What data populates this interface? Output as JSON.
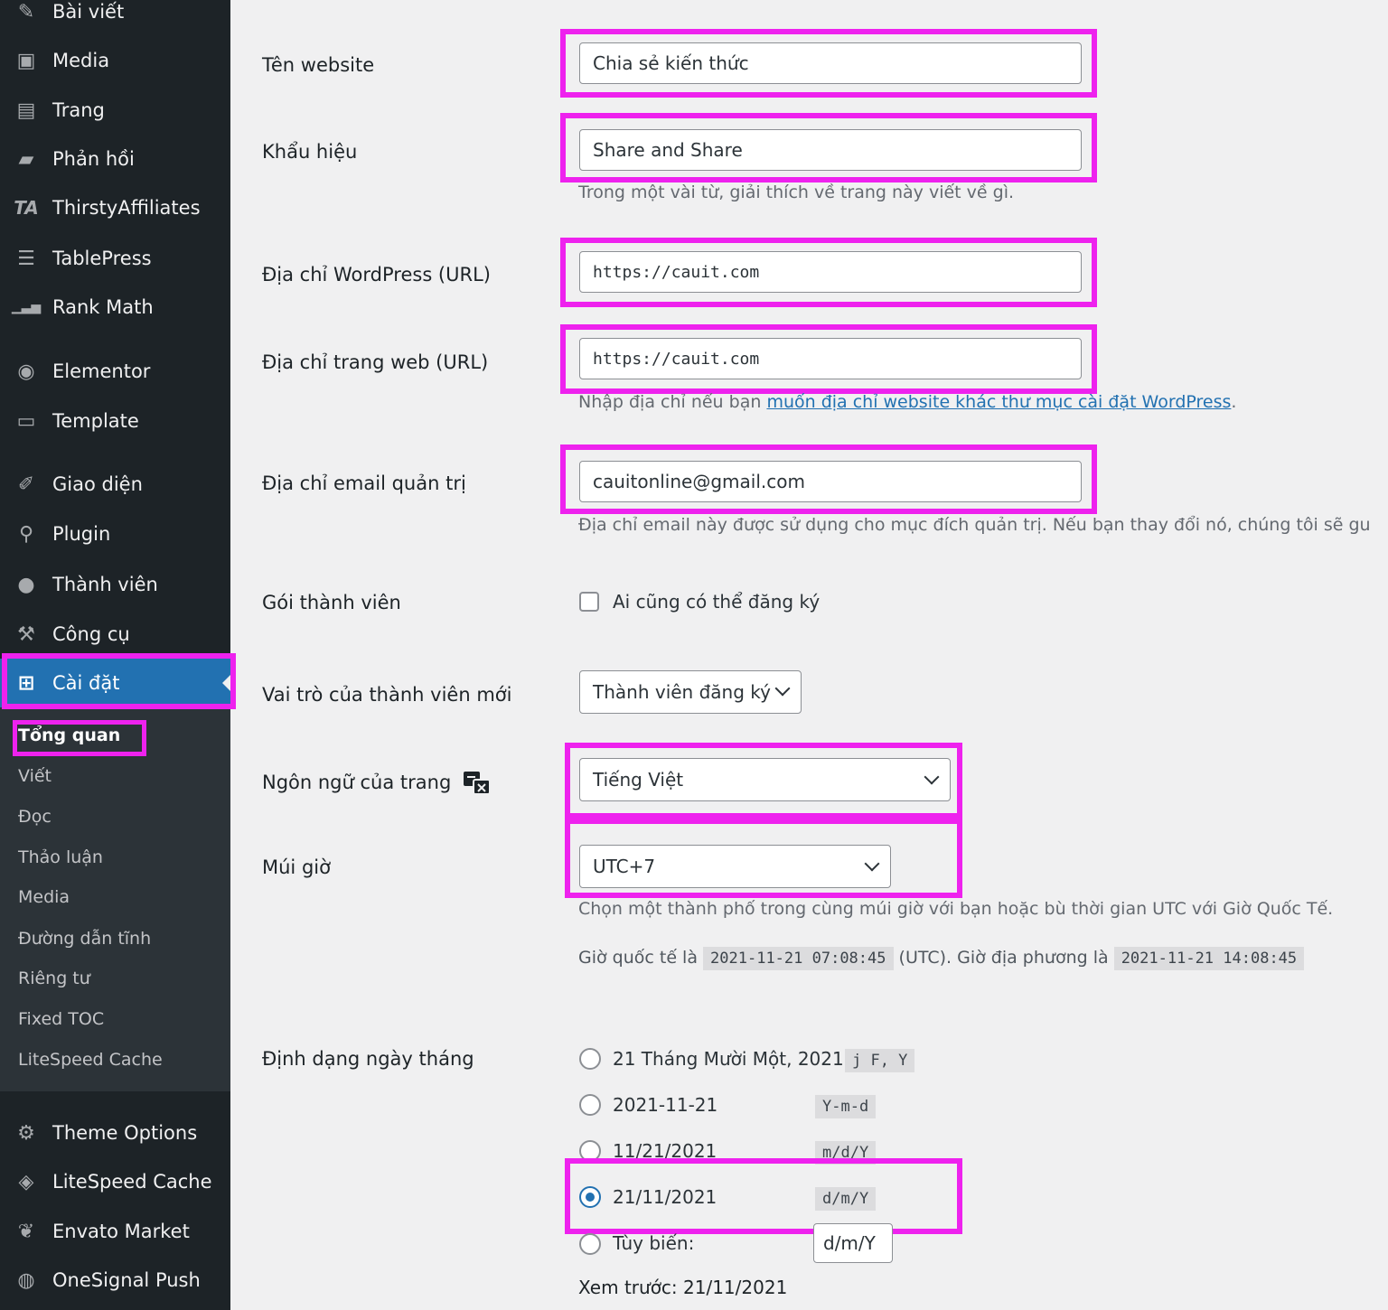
{
  "sidebar": {
    "items": [
      {
        "label": "Bài viết",
        "icon": "pin-icon",
        "glyph": "✎"
      },
      {
        "label": "Media",
        "icon": "media-icon",
        "glyph": "▣"
      },
      {
        "label": "Trang",
        "icon": "page-icon",
        "glyph": "▤"
      },
      {
        "label": "Phản hồi",
        "icon": "comment-icon",
        "glyph": "▰"
      },
      {
        "label": "ThirstyAffiliates",
        "icon": "ta-icon",
        "glyph": "TA"
      },
      {
        "label": "TablePress",
        "icon": "table-icon",
        "glyph": "☰"
      },
      {
        "label": "Rank Math",
        "icon": "rank-math-icon",
        "glyph": "▁▃▅"
      },
      {
        "label": "Elementor",
        "icon": "elementor-icon",
        "glyph": "◉"
      },
      {
        "label": "Template",
        "icon": "folder-icon",
        "glyph": "▭"
      },
      {
        "label": "Giao diện",
        "icon": "brush-icon",
        "glyph": "✐"
      },
      {
        "label": "Plugin",
        "icon": "plugin-icon",
        "glyph": "⚲"
      },
      {
        "label": "Thành viên",
        "icon": "user-icon",
        "glyph": "●"
      },
      {
        "label": "Công cụ",
        "icon": "wrench-icon",
        "glyph": "⚒"
      },
      {
        "label": "Cài đặt",
        "icon": "settings-icon",
        "glyph": "⊞"
      },
      {
        "label": "Theme Options",
        "icon": "gear-icon",
        "glyph": "⚙"
      },
      {
        "label": "LiteSpeed Cache",
        "icon": "diamond-icon",
        "glyph": "◈"
      },
      {
        "label": "Envato Market",
        "icon": "leaf-icon",
        "glyph": "❦"
      },
      {
        "label": "OneSignal Push",
        "icon": "bell-icon",
        "glyph": "◍"
      }
    ],
    "submenu": [
      "Tổng quan",
      "Viết",
      "Đọc",
      "Thảo luận",
      "Media",
      "Đường dẫn tĩnh",
      "Riêng tư",
      "Fixed TOC",
      "LiteSpeed Cache"
    ]
  },
  "form": {
    "site_title": {
      "label": "Tên website",
      "value": "Chia sẻ kiến thức"
    },
    "tagline": {
      "label": "Khẩu hiệu",
      "value": "Share and Share",
      "desc": "Trong một vài từ, giải thích về trang này viết về gì."
    },
    "wp_url": {
      "label": "Địa chỉ WordPress (URL)",
      "value": "https://cauit.com"
    },
    "site_url": {
      "label": "Địa chỉ trang web (URL)",
      "value": "https://cauit.com",
      "desc_prefix": "Nhập địa chỉ nếu bạn ",
      "desc_link": "muốn địa chỉ website khác thư mục cài đặt WordPress",
      "desc_suffix": "."
    },
    "admin_email": {
      "label": "Địa chỉ email quản trị",
      "value": "cauitonline@gmail.com",
      "desc": "Địa chỉ email này được sử dụng cho mục đích quản trị. Nếu bạn thay đổi nó, chúng tôi sẽ gu"
    },
    "membership": {
      "label": "Gói thành viên",
      "option": "Ai cũng có thể đăng ký"
    },
    "default_role": {
      "label": "Vai trò của thành viên mới",
      "value": "Thành viên đăng ký"
    },
    "language": {
      "label": "Ngôn ngữ của trang",
      "value": "Tiếng Việt"
    },
    "timezone": {
      "label": "Múi giờ",
      "value": "UTC+7",
      "desc": "Chọn một thành phố trong cùng múi giờ với bạn hoặc bù thời gian UTC với Giờ Quốc Tế.",
      "utc_prefix": "Giờ quốc tế là",
      "utc_time": "2021-11-21 07:08:45",
      "local_prefix": "(UTC). Giờ địa phương là",
      "local_time": "2021-11-21 14:08:45"
    },
    "date_format": {
      "label": "Định dạng ngày tháng",
      "options": [
        {
          "label": "21 Tháng Mười Một, 2021",
          "code": "j F, Y"
        },
        {
          "label": "2021-11-21",
          "code": "Y-m-d"
        },
        {
          "label": "11/21/2021",
          "code": "m/d/Y"
        },
        {
          "label": "21/11/2021",
          "code": "d/m/Y"
        }
      ],
      "custom_label": "Tùy biến:",
      "custom_value": "d/m/Y",
      "preview": "Xem trước: 21/11/2021"
    }
  },
  "colors": {
    "highlight": "#ee22ee",
    "sidebar_bg": "#1d2327",
    "active_bg": "#2271b1",
    "page_bg": "#f0f0f1"
  }
}
